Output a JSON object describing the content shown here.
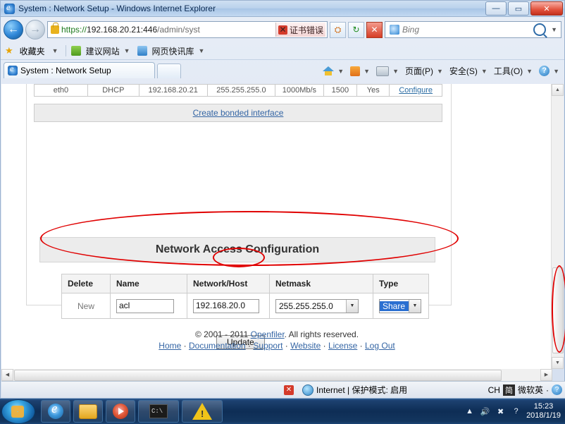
{
  "window": {
    "title": "System : Network Setup - Windows Internet Explorer",
    "min_label": "—",
    "max_label": "▭",
    "close_label": "✕"
  },
  "nav": {
    "back_label": "←",
    "forward_label": "→",
    "url_scheme": "https://",
    "url_host": "192.168.20.21:446",
    "url_path": "/admin/syst",
    "cert_error": "证书错误",
    "cert_x": "✕",
    "compat_label": "⛭",
    "refresh_label": "↻",
    "stop_label": "✕",
    "search_placeholder": "Bing",
    "search_value": "",
    "dropdown_caret": "▼"
  },
  "favorites": {
    "star_icon": "★",
    "label": "收藏夹",
    "items": [
      {
        "label": "建议网站",
        "caret": "▼"
      },
      {
        "label": "网页快讯库",
        "caret": "▼"
      }
    ]
  },
  "tabs": {
    "active": "System : Network Setup",
    "newtab_tooltip": ""
  },
  "commandbar": {
    "home": "",
    "feeds": "",
    "print": "",
    "page_menu": "页面(P)",
    "safety_menu": "安全(S)",
    "tools_menu": "工具(O)",
    "help_menu": "",
    "caret": "▼"
  },
  "page": {
    "interfaces_table": {
      "cells": [
        "eth0",
        "DHCP",
        "192.168.20.21",
        "255.255.255.0",
        "1000Mb/s",
        "1500",
        "Yes",
        "Configure"
      ]
    },
    "create_bonded_link": "Create bonded interface",
    "section_title": "Network Access Configuration",
    "table": {
      "headers": [
        "Delete",
        "Name",
        "Network/Host",
        "Netmask",
        "Type"
      ],
      "row": {
        "delete": "New",
        "name_value": "acl",
        "network_value": "192.168.20.0",
        "netmask_value": "255.255.255.0",
        "netmask_caret": "▼",
        "type_value": "Share",
        "type_caret": "▼"
      }
    },
    "update_button": "Update",
    "footer": {
      "copyright_prefix": "© 2001 - 2011 ",
      "copyright_link": "Openfiler",
      "copyright_suffix": ". All rights reserved.",
      "links": [
        "Home",
        "Documentation",
        "Support",
        "Website",
        "License",
        "Log Out"
      ],
      "separator": "·"
    }
  },
  "scrollbars": {
    "up_arrow": "▲",
    "down_arrow": "▼",
    "left_arrow": "◀",
    "right_arrow": "▶"
  },
  "statusbar": {
    "error_icon": "✕",
    "zone": "Internet | 保护模式: 启用",
    "ime": [
      "CH",
      "简",
      "微软英",
      "·",
      "︰"
    ],
    "zoom": "",
    "separator": "|"
  },
  "taskbar": {
    "start_tooltip": "",
    "items": [
      "internet-explorer",
      "explorer",
      "media-player",
      "command-prompt",
      "warning-app"
    ],
    "tray": [
      "▲",
      "volume",
      "network",
      "help"
    ],
    "clock_time": "15:23",
    "clock_date": "2018/1/19"
  }
}
